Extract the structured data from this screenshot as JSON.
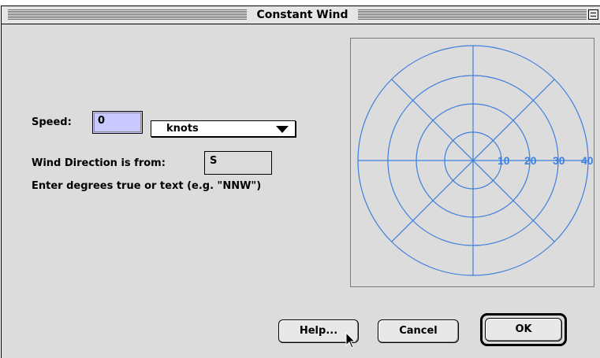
{
  "window": {
    "title": "Constant Wind"
  },
  "form": {
    "speed_label": "Speed:",
    "speed_value": "0",
    "units_selected": "knots",
    "direction_label": "Wind Direction is from:",
    "direction_value": "S",
    "hint": "Enter  degrees true or text (e.g. \"NNW\")"
  },
  "compass": {
    "ring_labels": [
      "10",
      "20",
      "30",
      "40"
    ],
    "line_color": "#3f7fdc",
    "label_color": "#3f7fdc"
  },
  "buttons": {
    "help_label": "Help...",
    "cancel_label": "Cancel",
    "ok_label": "OK"
  },
  "icons": {
    "zoom_box": "zoom-box-icon",
    "popup_arrow": "triangle-down-icon",
    "cursor": "arrow-cursor-icon"
  }
}
